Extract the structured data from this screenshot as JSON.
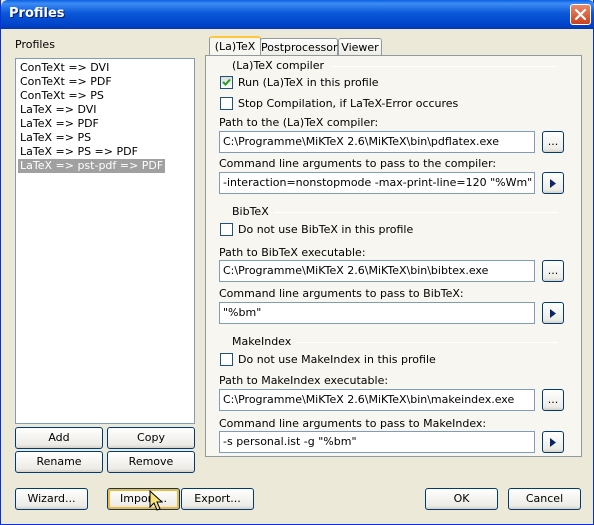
{
  "window": {
    "title": "Profiles"
  },
  "profiles": {
    "label": "Profiles",
    "items": [
      {
        "label": "ConTeXt => DVI"
      },
      {
        "label": "ConTeXt => PDF"
      },
      {
        "label": "ConTeXt => PS"
      },
      {
        "label": "LaTeX => DVI"
      },
      {
        "label": "LaTeX => PDF"
      },
      {
        "label": "LaTeX => PS"
      },
      {
        "label": "LaTeX => PS => PDF"
      },
      {
        "label": "LaTeX => pst-pdf => PDF"
      }
    ],
    "selected": "LaTeX => pst-pdf => PDF",
    "add": "Add",
    "copy": "Copy",
    "rename": "Rename",
    "remove": "Remove"
  },
  "tabs": [
    {
      "label": "(La)TeX"
    },
    {
      "label": "Postprocessor"
    },
    {
      "label": "Viewer"
    }
  ],
  "latex": {
    "group": "(La)TeX compiler",
    "run_check": "Run (La)TeX in this profile",
    "run_checked": true,
    "stop_check": "Stop Compilation, if LaTeX-Error occures",
    "stop_checked": false,
    "path_label": "Path to the (La)TeX compiler:",
    "path_value": "C:\\Programme\\MiKTeX 2.6\\MiKTeX\\bin\\pdflatex.exe",
    "args_label": "Command line arguments to pass to the compiler:",
    "args_value": "-interaction=nonstopmode -max-print-line=120 \"%Wm\""
  },
  "bibtex": {
    "group": "BibTeX",
    "nouse_check": "Do not use BibTeX in this profile",
    "nouse_checked": false,
    "path_label": "Path to BibTeX executable:",
    "path_value": "C:\\Programme\\MiKTeX 2.6\\MiKTeX\\bin\\bibtex.exe",
    "args_label": "Command line arguments to pass to BibTeX:",
    "args_value": "\"%bm\""
  },
  "makeindex": {
    "group": "MakeIndex",
    "nouse_check": "Do not use MakeIndex in this profile",
    "nouse_checked": false,
    "path_label": "Path to MakeIndex executable:",
    "path_value": "C:\\Programme\\MiKTeX 2.6\\MiKTeX\\bin\\makeindex.exe",
    "args_label": "Command line arguments to pass to MakeIndex:",
    "args_value": "-s personal.ist -g \"%bm\""
  },
  "browse": "...",
  "footer": {
    "wizard": "Wizard...",
    "import": "Import...",
    "export": "Export...",
    "ok": "OK",
    "cancel": "Cancel"
  }
}
